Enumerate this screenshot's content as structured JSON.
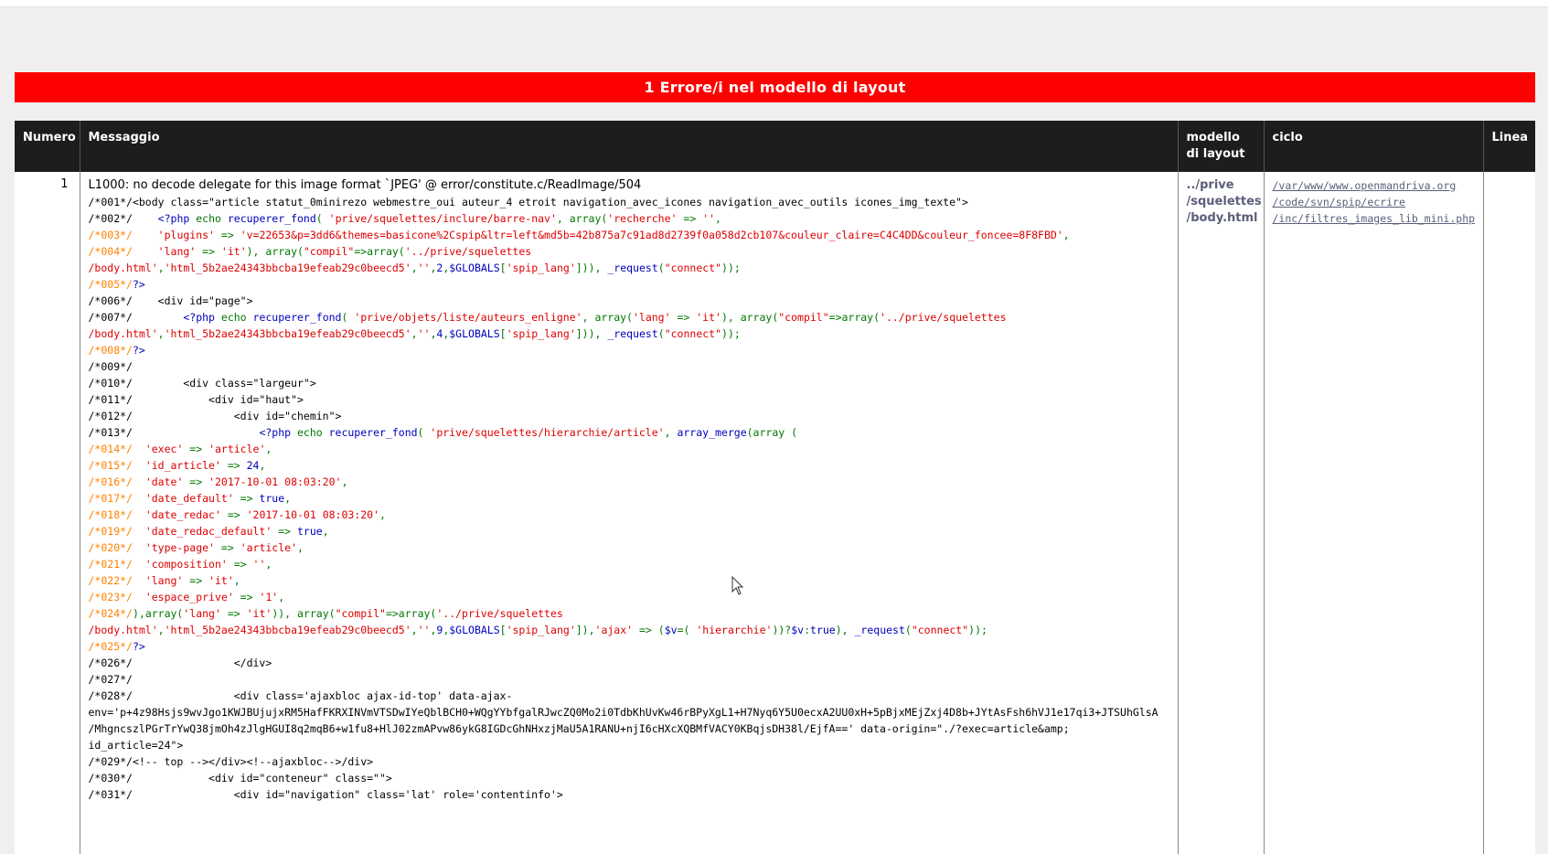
{
  "banner": {
    "title": "1 Errore/i nel modello di layout"
  },
  "table": {
    "headers": {
      "numero": "Numero",
      "messaggio": "Messaggio",
      "modello": "modello di layout",
      "ciclo": "ciclo",
      "linea": "Linea"
    },
    "row": {
      "numero": "1",
      "error": "L1000: no decode delegate for this image format `JPEG' @ error/constitute.c/ReadImage/504",
      "template_lines": [
        "../prive",
        "/squelettes",
        "/body.html"
      ],
      "loop_lines": [
        "/var/www/www.openmandriva.org",
        "/code/svn/spip/ecrire",
        "/inc/filtres_images_lib_mini.php"
      ],
      "linea": ""
    }
  },
  "code_lines": [
    [
      [
        "",
        "/*001*/<body class=\"article statut_0minirezo webmestre_oui auteur_4 etroit navigation_avec_icones navigation_avec_outils icones_img_texte\">"
      ]
    ],
    [
      [
        "",
        "/*002*/    "
      ],
      [
        "k",
        "<?php "
      ],
      [
        "g",
        "echo "
      ],
      [
        "k",
        "recuperer_fond"
      ],
      [
        "g",
        "( "
      ],
      [
        "s",
        "'prive/squelettes/inclure/barre-nav'"
      ],
      [
        "g",
        ", "
      ],
      [
        "g",
        "array("
      ],
      [
        "s",
        "'recherche'"
      ],
      [
        "g",
        " => "
      ],
      [
        "s",
        "''"
      ],
      [
        "g",
        ","
      ]
    ],
    [
      [
        "o",
        "/*003*/    "
      ],
      [
        "s",
        "'plugins'"
      ],
      [
        "g",
        " => "
      ],
      [
        "s",
        "'v=22653&p=3dd6&themes=basicone%2Cspip&ltr=left&md5b=42b875a7c91ad8d2739f0a058d2cb107&couleur_claire=C4C4DD&couleur_foncee=8F8FBD'"
      ],
      [
        "g",
        ","
      ]
    ],
    [
      [
        "o",
        "/*004*/    "
      ],
      [
        "s",
        "'lang'"
      ],
      [
        "g",
        " => "
      ],
      [
        "s",
        "'it'"
      ],
      [
        "g",
        "), array("
      ],
      [
        "s",
        "\"compil\""
      ],
      [
        "g",
        "=>array("
      ],
      [
        "s",
        "'../prive/squelettes"
      ]
    ],
    [
      [
        "s",
        "/body.html'"
      ],
      [
        "g",
        ","
      ],
      [
        "s",
        "'html_5b2ae24343bbcba19efeab29c0beecd5'"
      ],
      [
        "g",
        ","
      ],
      [
        "s",
        "''"
      ],
      [
        "g",
        ","
      ],
      [
        "k",
        "2"
      ],
      [
        "g",
        ","
      ],
      [
        "k",
        "$GLOBALS"
      ],
      [
        "g",
        "["
      ],
      [
        "s",
        "'spip_lang'"
      ],
      [
        "g",
        "])), "
      ],
      [
        "k",
        "_request"
      ],
      [
        "g",
        "("
      ],
      [
        "s",
        "\"connect\""
      ],
      [
        "g",
        "));"
      ]
    ],
    [
      [
        "o",
        "/*005*/"
      ],
      [
        "k",
        "?>"
      ]
    ],
    [
      [
        "",
        "/*006*/    <div id=\"page\">"
      ]
    ],
    [
      [
        "",
        "/*007*/        "
      ],
      [
        "k",
        "<?php "
      ],
      [
        "g",
        "echo "
      ],
      [
        "k",
        "recuperer_fond"
      ],
      [
        "g",
        "( "
      ],
      [
        "s",
        "'prive/objets/liste/auteurs_enligne'"
      ],
      [
        "g",
        ", "
      ],
      [
        "g",
        "array("
      ],
      [
        "s",
        "'lang'"
      ],
      [
        "g",
        " => "
      ],
      [
        "s",
        "'it'"
      ],
      [
        "g",
        "), array("
      ],
      [
        "s",
        "\"compil\""
      ],
      [
        "g",
        "=>array("
      ],
      [
        "s",
        "'../prive/squelettes"
      ]
    ],
    [
      [
        "s",
        "/body.html'"
      ],
      [
        "g",
        ","
      ],
      [
        "s",
        "'html_5b2ae24343bbcba19efeab29c0beecd5'"
      ],
      [
        "g",
        ","
      ],
      [
        "s",
        "''"
      ],
      [
        "g",
        ","
      ],
      [
        "k",
        "4"
      ],
      [
        "g",
        ","
      ],
      [
        "k",
        "$GLOBALS"
      ],
      [
        "g",
        "["
      ],
      [
        "s",
        "'spip_lang'"
      ],
      [
        "g",
        "])), "
      ],
      [
        "k",
        "_request"
      ],
      [
        "g",
        "("
      ],
      [
        "s",
        "\"connect\""
      ],
      [
        "g",
        "));"
      ]
    ],
    [
      [
        "o",
        "/*008*/"
      ],
      [
        "k",
        "?>"
      ]
    ],
    [
      [
        "",
        "/*009*/"
      ]
    ],
    [
      [
        "",
        "/*010*/        <div class=\"largeur\">"
      ]
    ],
    [
      [
        "",
        "/*011*/            <div id=\"haut\">"
      ]
    ],
    [
      [
        "",
        "/*012*/                <div id=\"chemin\">"
      ]
    ],
    [
      [
        "",
        "/*013*/                    "
      ],
      [
        "k",
        "<?php "
      ],
      [
        "g",
        "echo "
      ],
      [
        "k",
        "recuperer_fond"
      ],
      [
        "g",
        "( "
      ],
      [
        "s",
        "'prive/squelettes/hierarchie/article'"
      ],
      [
        "g",
        ", "
      ],
      [
        "k",
        "array_merge"
      ],
      [
        "g",
        "(array ("
      ]
    ],
    [
      [
        "o",
        "/*014*/  "
      ],
      [
        "s",
        "'exec'"
      ],
      [
        "g",
        " => "
      ],
      [
        "s",
        "'article'"
      ],
      [
        "g",
        ","
      ]
    ],
    [
      [
        "o",
        "/*015*/  "
      ],
      [
        "s",
        "'id_article'"
      ],
      [
        "g",
        " => "
      ],
      [
        "k",
        "24"
      ],
      [
        "g",
        ","
      ]
    ],
    [
      [
        "o",
        "/*016*/  "
      ],
      [
        "s",
        "'date'"
      ],
      [
        "g",
        " => "
      ],
      [
        "s",
        "'2017-10-01 08:03:20'"
      ],
      [
        "g",
        ","
      ]
    ],
    [
      [
        "o",
        "/*017*/  "
      ],
      [
        "s",
        "'date_default'"
      ],
      [
        "g",
        " => "
      ],
      [
        "k",
        "true"
      ],
      [
        "g",
        ","
      ]
    ],
    [
      [
        "o",
        "/*018*/  "
      ],
      [
        "s",
        "'date_redac'"
      ],
      [
        "g",
        " => "
      ],
      [
        "s",
        "'2017-10-01 08:03:20'"
      ],
      [
        "g",
        ","
      ]
    ],
    [
      [
        "o",
        "/*019*/  "
      ],
      [
        "s",
        "'date_redac_default'"
      ],
      [
        "g",
        " => "
      ],
      [
        "k",
        "true"
      ],
      [
        "g",
        ","
      ]
    ],
    [
      [
        "o",
        "/*020*/  "
      ],
      [
        "s",
        "'type-page'"
      ],
      [
        "g",
        " => "
      ],
      [
        "s",
        "'article'"
      ],
      [
        "g",
        ","
      ]
    ],
    [
      [
        "o",
        "/*021*/  "
      ],
      [
        "s",
        "'composition'"
      ],
      [
        "g",
        " => "
      ],
      [
        "s",
        "''"
      ],
      [
        "g",
        ","
      ]
    ],
    [
      [
        "o",
        "/*022*/  "
      ],
      [
        "s",
        "'lang'"
      ],
      [
        "g",
        " => "
      ],
      [
        "s",
        "'it'"
      ],
      [
        "g",
        ","
      ]
    ],
    [
      [
        "o",
        "/*023*/  "
      ],
      [
        "s",
        "'espace_prive'"
      ],
      [
        "g",
        " => "
      ],
      [
        "s",
        "'1'"
      ],
      [
        "g",
        ","
      ]
    ],
    [
      [
        "o",
        "/*024*/"
      ],
      [
        "g",
        "),array("
      ],
      [
        "s",
        "'lang'"
      ],
      [
        "g",
        " => "
      ],
      [
        "s",
        "'it'"
      ],
      [
        "g",
        ")), array("
      ],
      [
        "s",
        "\"compil\""
      ],
      [
        "g",
        "=>array("
      ],
      [
        "s",
        "'../prive/squelettes"
      ]
    ],
    [
      [
        "s",
        "/body.html'"
      ],
      [
        "g",
        ","
      ],
      [
        "s",
        "'html_5b2ae24343bbcba19efeab29c0beecd5'"
      ],
      [
        "g",
        ","
      ],
      [
        "s",
        "''"
      ],
      [
        "g",
        ","
      ],
      [
        "k",
        "9"
      ],
      [
        "g",
        ","
      ],
      [
        "k",
        "$GLOBALS"
      ],
      [
        "g",
        "["
      ],
      [
        "s",
        "'spip_lang'"
      ],
      [
        "g",
        "]),"
      ],
      [
        "s",
        "'ajax'"
      ],
      [
        "g",
        " => ("
      ],
      [
        "k",
        "$v"
      ],
      [
        "g",
        "=( "
      ],
      [
        "s",
        "'hierarchie'"
      ],
      [
        "g",
        "))?"
      ],
      [
        "k",
        "$v"
      ],
      [
        "g",
        ":"
      ],
      [
        "k",
        "true"
      ],
      [
        "g",
        "), "
      ],
      [
        "k",
        "_request"
      ],
      [
        "g",
        "("
      ],
      [
        "s",
        "\"connect\""
      ],
      [
        "g",
        "));"
      ]
    ],
    [
      [
        "o",
        "/*025*/"
      ],
      [
        "k",
        "?>"
      ]
    ],
    [
      [
        "",
        "/*026*/                </div>"
      ]
    ],
    [
      [
        "",
        "/*027*/"
      ]
    ],
    [
      [
        "",
        "/*028*/                <div class='ajaxbloc ajax-id-top' data-ajax-"
      ]
    ],
    [
      [
        "",
        "env='p+4z98Hsjs9wvJgo1KWJBUjujxRM5HafFKRXINVmVTSDwIYeQblBCH0+WQgYYbfgalRJwcZQ0Mo2i0TdbKhUvKw46rBPyXgL1+H7Nyq6Y5U0ecxA2UU0xH+5pBjxMEjZxj4D8b+JYtAsFsh6hVJ1e17qi3+JTSUhGlsA"
      ]
    ],
    [
      [
        "",
        "/MhgncszlPGrTrYwQ38jmOh4zJlgHGUI8q2mqB6+w1fu8+HlJ02zmAPvw86ykG8IGDcGhNHxzjMaU5A1RANU+njI6cHXcXQBMfVACY0KBqjsDH38l/EjfA==' data-origin=\"./?exec=article&amp;"
      ]
    ],
    [
      [
        "",
        "id_article=24\">"
      ]
    ],
    [
      [
        "",
        "/*029*/<!-- top --></div><!--ajaxbloc-->/div>"
      ]
    ],
    [
      [
        "",
        "/*030*/            <div id=\"conteneur\" class=\"\">"
      ]
    ],
    [
      [
        "",
        "/*031*/                <div id=\"navigation\" class='lat' role='contentinfo'>"
      ]
    ]
  ]
}
